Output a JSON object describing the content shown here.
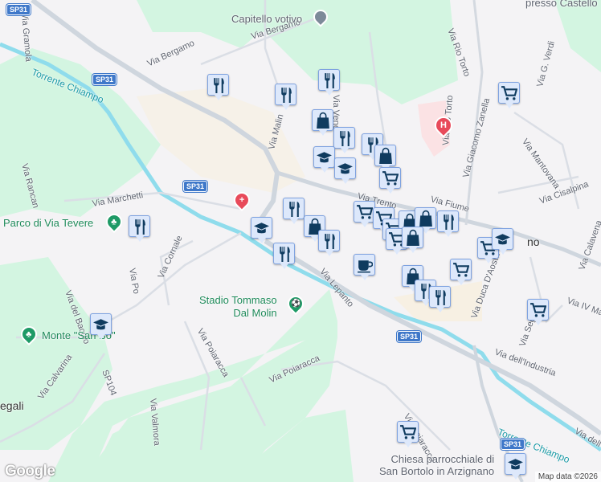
{
  "map": {
    "streets": [
      "Via Bergamo",
      "Via Bergamo",
      "Via Malin",
      "Via Venezia",
      "Via Rio Torto",
      "Via Rio Torto",
      "Via G. Verdi",
      "Via Mantovana",
      "Via Giacomo Zanella",
      "Via Cisalpina",
      "Via Fiume",
      "Via Trento",
      "Via Marchetti",
      "Via Rancan",
      "Via Po",
      "Via Cornale",
      "Via del Bacolo",
      "Via Lepanto",
      "Via Poiaracca",
      "Via Poiaracca",
      "Via Poiaracca",
      "Via Calvarina",
      "SP104",
      "Via Valmora",
      "Via Duca D'Aosta",
      "Via Sega",
      "Via IV Martiri",
      "Via Calavena",
      "Via dell'Industria",
      "Via dell'Industria",
      "Via Gramola"
    ],
    "road_shields": [
      "SP31",
      "SP31",
      "SP31",
      "SP31",
      "SP31"
    ],
    "waterways": [
      "Torrente Chiampo",
      "Torrente Chiampo"
    ],
    "places": {
      "capitello": "Capitello votivo",
      "castello": "presso Castello",
      "parco": "Parco di Via Tevere",
      "stadio_1": "Stadio Tommaso",
      "stadio_2": "Dal Molin",
      "monte": "Monte \"San Bo\"",
      "chiesa_1": "Chiesa parrocchiale di",
      "chiesa_2": "San Bortolo in Arzignano",
      "town_edge": "no",
      "west_edge": "egali"
    },
    "hospital_symbol": "H",
    "markers": [
      "restaurant-icon",
      "restaurant-icon",
      "restaurant-icon",
      "shopping-cart-icon",
      "shopping-bag-icon",
      "restaurant-icon",
      "restaurant-icon",
      "shopping-bag-icon",
      "school-icon",
      "school-icon",
      "shopping-cart-icon",
      "restaurant-icon",
      "school-icon",
      "shopping-bag-icon",
      "restaurant-icon",
      "restaurant-icon",
      "restaurant-icon",
      "shopping-cart-icon",
      "shopping-cart-icon",
      "shopping-cart-icon",
      "shopping-bag-icon",
      "shopping-cart-icon",
      "shopping-bag-icon",
      "shopping-bag-icon",
      "restaurant-icon",
      "cafe-icon",
      "shopping-bag-icon",
      "shopping-cart-icon",
      "restaurant-icon",
      "restaurant-icon",
      "shopping-cart-icon",
      "school-icon",
      "shopping-cart-icon",
      "school-icon",
      "shopping-cart-icon",
      "school-icon"
    ],
    "branding": "Google",
    "attribution": "Map data ©2026"
  },
  "colors": {
    "marker_bg": "#dde8fb",
    "marker_icon": "#0f3b5f",
    "park": "#d3f5e1",
    "hospital": "#e84a5a",
    "river": "#8fdcec"
  }
}
